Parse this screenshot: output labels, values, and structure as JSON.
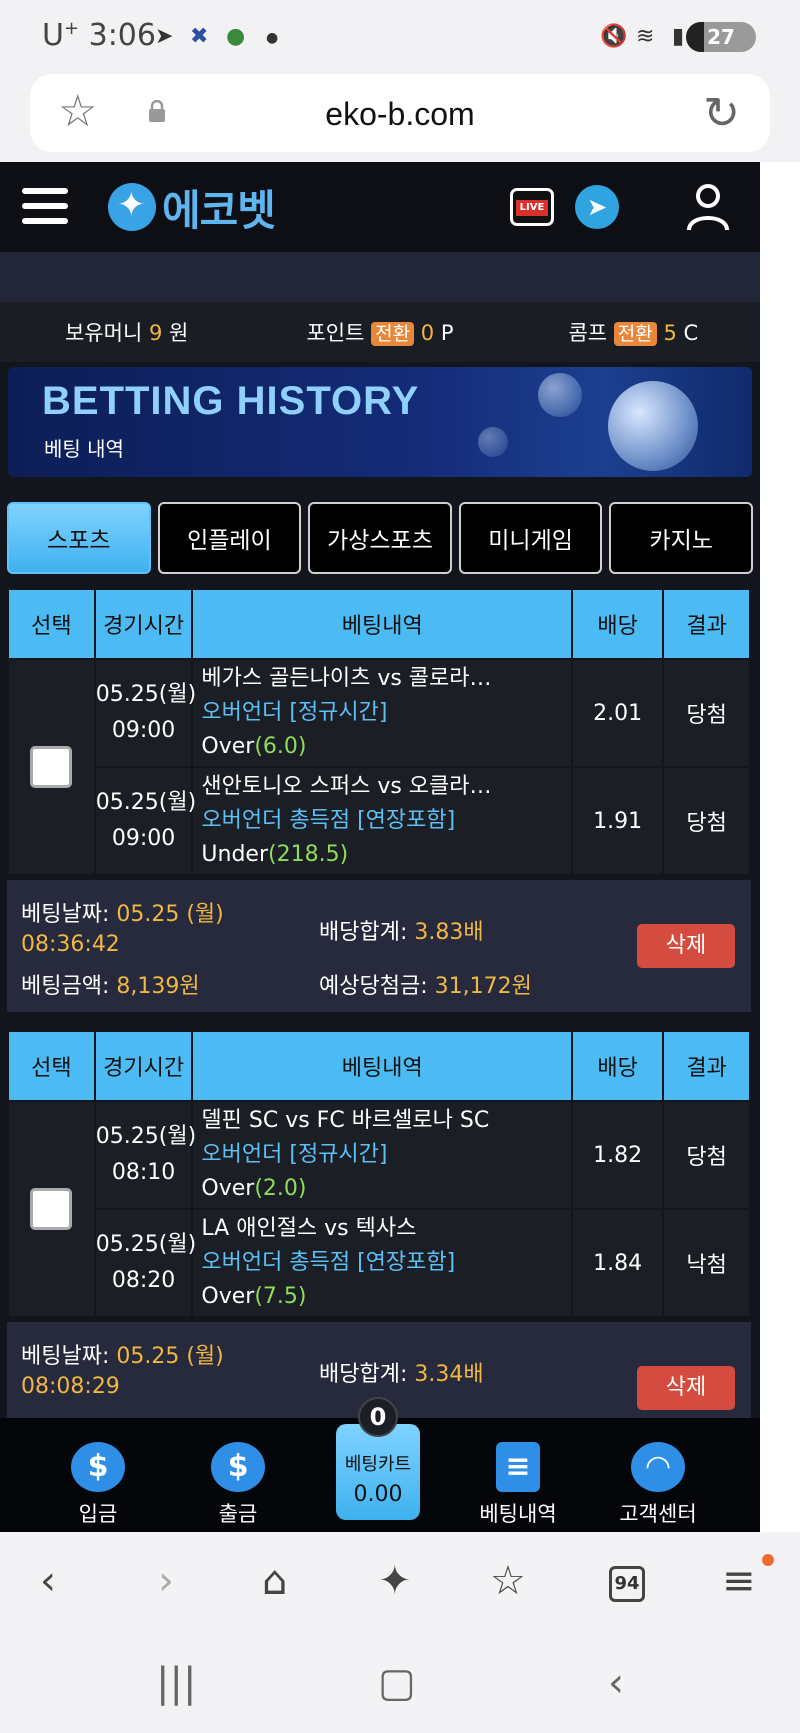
{
  "status": {
    "carrier": "U",
    "carrier_sup": "+",
    "time": "3:06",
    "battery": "27"
  },
  "browser": {
    "url": "eko-b.com",
    "tab_count": "94"
  },
  "header": {
    "logo_text": "에코벳",
    "live_label": "LIVE"
  },
  "wallet": {
    "money_label": "보유머니",
    "money_value": "9",
    "money_unit": "원",
    "point_label": "포인트",
    "point_convert": "전환",
    "point_value": "0",
    "point_unit": "P",
    "comp_label": "콤프",
    "comp_convert": "전환",
    "comp_value": "5",
    "comp_unit": "C"
  },
  "banner": {
    "title": "BETTING HISTORY",
    "subtitle": "베팅 내역"
  },
  "tabs": [
    "스포츠",
    "인플레이",
    "가상스포츠",
    "미니게임",
    "카지노"
  ],
  "table_headers": [
    "선택",
    "경기시간",
    "베팅내역",
    "배당",
    "결과"
  ],
  "bets": [
    {
      "rows": [
        {
          "date": "05.25(월)",
          "time": "09:00",
          "match": "베가스 골든나이츠 vs 콜로라…",
          "market": "오버언더 [정규시간]",
          "pick": "Over",
          "line": "(6.0)",
          "odds": "2.01",
          "result": "당첨"
        },
        {
          "date": "05.25(월)",
          "time": "09:00",
          "match": "샌안토니오 스퍼스 vs 오클라…",
          "market": "오버언더 총득점 [연장포함]",
          "pick": "Under",
          "line": "(218.5)",
          "odds": "1.91",
          "result": "당첨"
        }
      ],
      "bet_date_label": "베팅날짜:",
      "bet_date": "05.25 (월)",
      "bet_time": "08:36:42",
      "amount_label": "베팅금액:",
      "amount": "8,139원",
      "total_odds_label": "배당합계:",
      "total_odds": "3.83배",
      "expected_label": "예상당첨금:",
      "expected": "31,172원",
      "delete_label": "삭제"
    },
    {
      "rows": [
        {
          "date": "05.25(월)",
          "time": "08:10",
          "match": "델핀 SC vs FC 바르셀로나 SC",
          "market": "오버언더 [정규시간]",
          "pick": "Over",
          "line": "(2.0)",
          "odds": "1.82",
          "result": "당첨"
        },
        {
          "date": "05.25(월)",
          "time": "08:20",
          "match": "LA 애인절스 vs 텍사스",
          "market": "오버언더 총득점 [연장포함]",
          "pick": "Over",
          "line": "(7.5)",
          "odds": "1.84",
          "result": "낙첨"
        }
      ],
      "bet_date_label": "베팅날짜:",
      "bet_date": "05.25 (월)",
      "bet_time": "08:08:29",
      "total_odds_label": "배당합계:",
      "total_odds": "3.34배",
      "delete_label": "삭제"
    }
  ],
  "bottom_nav": {
    "deposit": "입금",
    "withdraw": "출금",
    "cart_label": "베팅카트",
    "cart_value": "0.00",
    "cart_count": "0",
    "history": "베팅내역",
    "support": "고객센터"
  },
  "colors": {
    "accent": "#4cbaf3",
    "win": "#8fdb5a",
    "lose": "#e8554b",
    "highlight": "#f1b743",
    "delete": "#d44b3f"
  }
}
